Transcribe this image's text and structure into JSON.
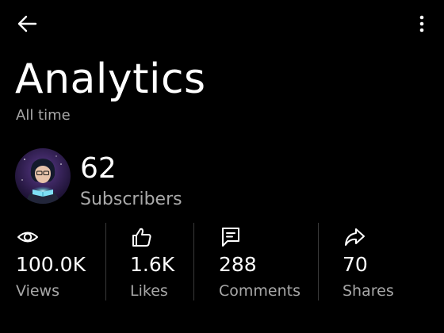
{
  "header": {
    "back_icon": "arrow-left-icon",
    "menu_icon": "more-vert-icon"
  },
  "page": {
    "title": "Analytics",
    "period": "All time"
  },
  "channel": {
    "avatar": "avatar",
    "subscriber_count": "62",
    "subscriber_label": "Subscribers"
  },
  "stats": [
    {
      "icon": "eye-icon",
      "value": "100.0K",
      "label": "Views"
    },
    {
      "icon": "thumbs-up-icon",
      "value": "1.6K",
      "label": "Likes"
    },
    {
      "icon": "comment-icon",
      "value": "288",
      "label": "Comments"
    },
    {
      "icon": "share-icon",
      "value": "70",
      "label": "Shares"
    }
  ],
  "colors": {
    "background": "#000000",
    "text": "#ffffff",
    "muted_text": "#a8a8a8",
    "divider": "#3a3a3a"
  }
}
